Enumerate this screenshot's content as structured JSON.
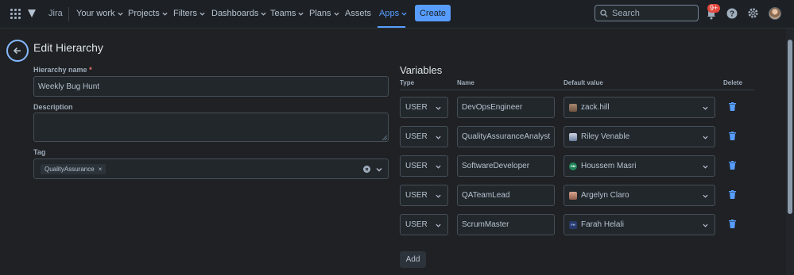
{
  "nav": {
    "brand": "Jira",
    "items": [
      {
        "label": "Your work",
        "dropdown": true
      },
      {
        "label": "Projects",
        "dropdown": true
      },
      {
        "label": "Filters",
        "dropdown": true
      },
      {
        "label": "Dashboards",
        "dropdown": true
      },
      {
        "label": "Teams",
        "dropdown": true
      },
      {
        "label": "Plans",
        "dropdown": true
      },
      {
        "label": "Assets",
        "dropdown": false
      },
      {
        "label": "Apps",
        "dropdown": true,
        "active": true
      }
    ],
    "create_label": "Create",
    "search_placeholder": "Search",
    "notifications_badge": "9+",
    "accent_color": "#579dff",
    "badge_color": "#e2483d"
  },
  "page": {
    "title": "Edit Hierarchy"
  },
  "form": {
    "hierarchy_name_label": "Hierarchy name",
    "required_marker": "*",
    "hierarchy_name_value": "Weekly Bug Hunt",
    "description_label": "Description",
    "description_value": "",
    "tag_label": "Tag",
    "tags": [
      "QualityAssurance"
    ],
    "tag_remove": "×"
  },
  "variables": {
    "title": "Variables",
    "columns": {
      "type": "Type",
      "name": "Name",
      "default": "Default value",
      "delete": "Delete"
    },
    "rows": [
      {
        "type": "USER",
        "name": "DevOpsEngineer",
        "default": "zack.hill",
        "avatar": "photo",
        "avatar_text": ""
      },
      {
        "type": "USER",
        "name": "QualityAssuranceAnalyst",
        "default": "Riley Venable",
        "avatar": "photo",
        "avatar_text": ""
      },
      {
        "type": "USER",
        "name": "SoftwareDeveloper",
        "default": "Houssem Masri",
        "avatar": "initials-green",
        "avatar_text": "HM"
      },
      {
        "type": "USER",
        "name": "QATeamLead",
        "default": "Argelyn Claro",
        "avatar": "photo",
        "avatar_text": ""
      },
      {
        "type": "USER",
        "name": "ScrumMaster",
        "default": "Farah Helali",
        "avatar": "initials-dark",
        "avatar_text": "FH"
      }
    ],
    "add_label": "Add",
    "delete_icon_color": "#579dff"
  }
}
